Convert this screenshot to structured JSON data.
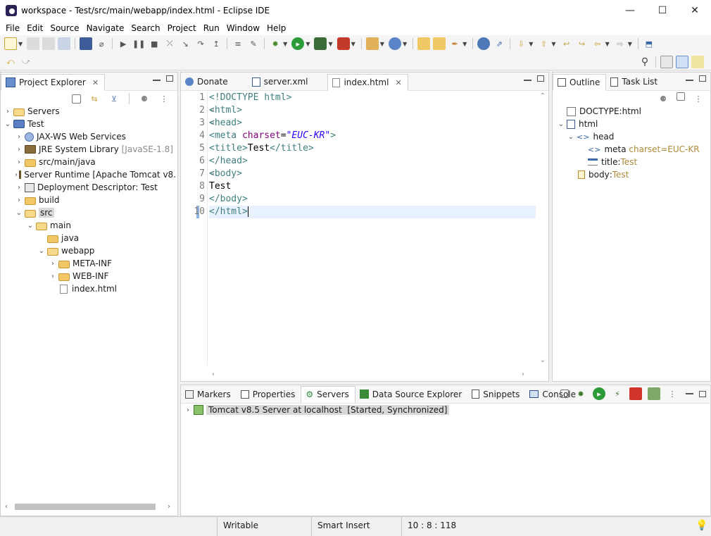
{
  "window": {
    "title": "workspace - Test/src/main/webapp/index.html - Eclipse IDE",
    "minimize_glyph": "—",
    "maximize_glyph": "☐",
    "close_glyph": "✕"
  },
  "menu": [
    "File",
    "Edit",
    "Source",
    "Navigate",
    "Search",
    "Project",
    "Run",
    "Window",
    "Help"
  ],
  "project_explorer": {
    "tab_label": "Project Explorer",
    "tree": [
      {
        "label": "Servers",
        "extra": ""
      },
      {
        "label": "Test",
        "extra": ""
      },
      {
        "label": "JAX-WS Web Services",
        "extra": ""
      },
      {
        "label": "JRE System Library",
        "extra": "[JavaSE-1.8]"
      },
      {
        "label": "src/main/java",
        "extra": ""
      },
      {
        "label": "Server Runtime [Apache Tomcat v8.",
        "extra": ""
      },
      {
        "label": "Deployment Descriptor: Test",
        "extra": ""
      },
      {
        "label": "build",
        "extra": ""
      },
      {
        "label": "src",
        "extra": ""
      },
      {
        "label": "main",
        "extra": ""
      },
      {
        "label": "java",
        "extra": ""
      },
      {
        "label": "webapp",
        "extra": ""
      },
      {
        "label": "META-INF",
        "extra": ""
      },
      {
        "label": "WEB-INF",
        "extra": ""
      },
      {
        "label": "index.html",
        "extra": ""
      }
    ]
  },
  "editor": {
    "tabs": [
      {
        "label": "Donate",
        "active": false
      },
      {
        "label": "server.xml",
        "active": false
      },
      {
        "label": "index.html",
        "active": true
      }
    ],
    "line_numbers": [
      "1",
      "2",
      "3",
      "4",
      "5",
      "6",
      "7",
      "8",
      "9",
      "10"
    ],
    "code": {
      "l1": "<!DOCTYPE html>",
      "l2": "<html>",
      "l3": "<head>",
      "l4_open": "<meta",
      "l4_attr": " charset",
      "l4_eq": "=",
      "l4_val": "\"EUC-KR\"",
      "l4_close": ">",
      "l5_open": "<title>",
      "l5_text": "Test",
      "l5_close": "</title>",
      "l6": "</head>",
      "l7": "<body>",
      "l8": "Test",
      "l9": "</body>",
      "l10": "</html>"
    }
  },
  "outline": {
    "tabs": [
      "Outline",
      "Task List"
    ],
    "items": [
      {
        "label": "DOCTYPE:html",
        "extra": ""
      },
      {
        "label": "html",
        "extra": ""
      },
      {
        "label": "head",
        "extra": ""
      },
      {
        "label": "meta",
        "extra": "charset=EUC-KR"
      },
      {
        "label": "title",
        "sep": " : ",
        "extra": "Test"
      },
      {
        "label": "body",
        "sep": " : ",
        "extra": "Test"
      }
    ]
  },
  "bottom": {
    "tabs": [
      "Markers",
      "Properties",
      "Servers",
      "Data Source Explorer",
      "Snippets",
      "Console"
    ],
    "server_row": {
      "name": "Tomcat v8.5 Server at localhost",
      "state": "[Started, Synchronized]"
    }
  },
  "status": {
    "writable": "Writable",
    "insert_mode": "Smart Insert",
    "position": "10 : 8 : 118"
  },
  "colors": {
    "tag": "#3f7f7f",
    "attr": "#7f007f",
    "value": "#2a00ff",
    "current_line": "#e8f2fe"
  }
}
